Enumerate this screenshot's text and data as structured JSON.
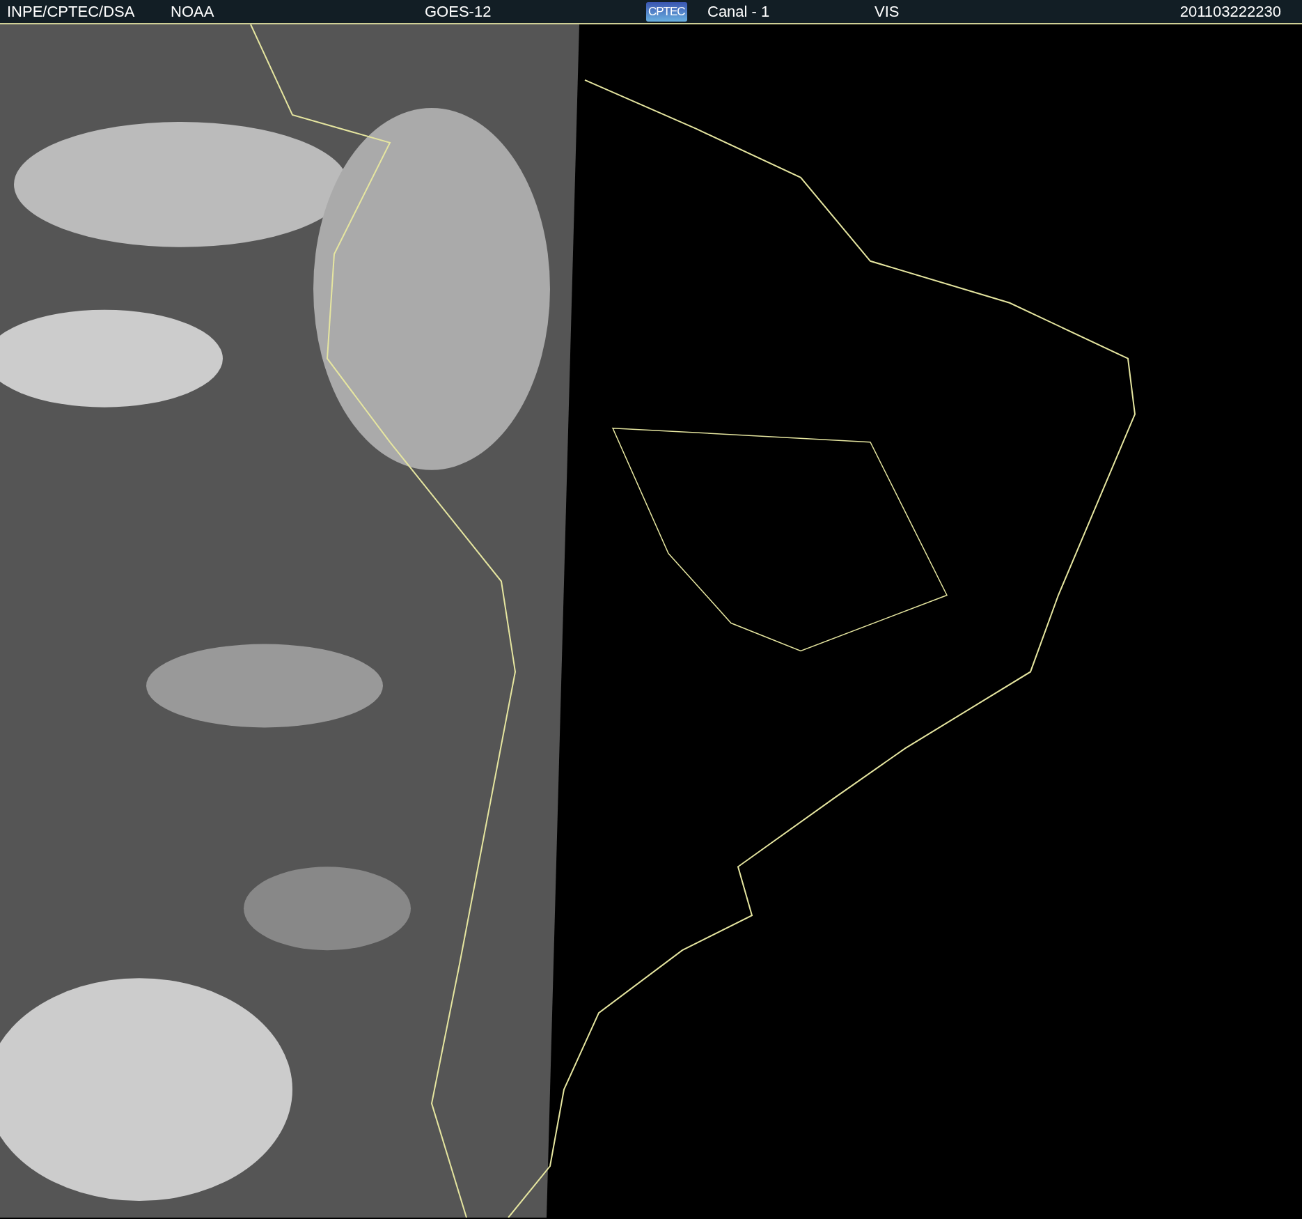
{
  "header": {
    "items": [
      {
        "kind": "text",
        "text": "INPE/CPTEC/DSA"
      },
      {
        "kind": "text",
        "text": "NOAA"
      },
      {
        "kind": "text",
        "text": "GOES-12"
      },
      {
        "kind": "logo",
        "text": "CPTEC"
      },
      {
        "kind": "text",
        "text": "Canal - 1"
      },
      {
        "kind": "text",
        "text": "VIS"
      },
      {
        "kind": "text",
        "text": "201103222230"
      }
    ]
  }
}
